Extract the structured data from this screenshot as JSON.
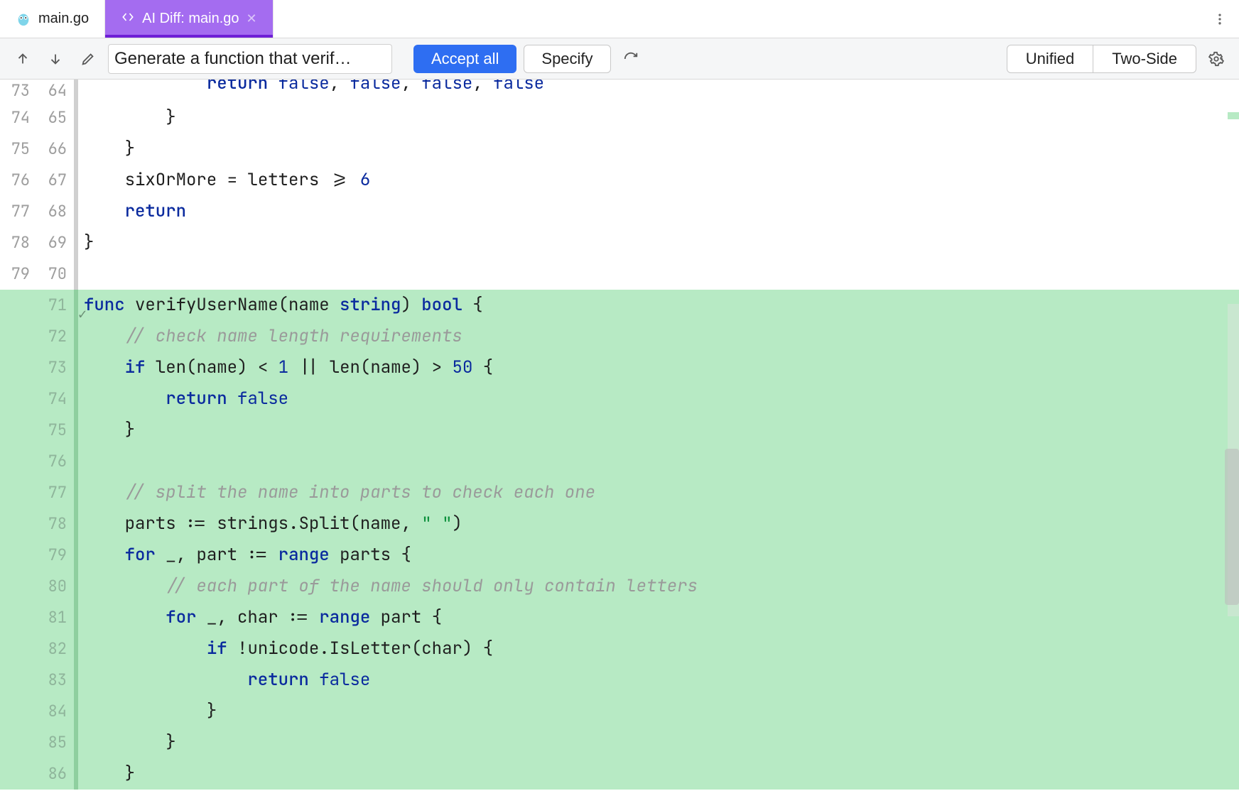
{
  "tabs": {
    "file_tab": {
      "label": "main.go"
    },
    "diff_tab": {
      "label": "AI Diff: main.go"
    }
  },
  "toolbar": {
    "prompt_label": "Generate a function that verif…",
    "accept_label": "Accept all",
    "specify_label": "Specify",
    "view_unified": "Unified",
    "view_twoside": "Two-Side"
  },
  "lines": [
    {
      "lold": "73",
      "lnew": "64",
      "added": false,
      "peek": true,
      "tokens": [
        [
          "",
          "            "
        ],
        [
          "kw",
          "return"
        ],
        [
          "",
          " "
        ],
        [
          "bool",
          "false"
        ],
        [
          "op",
          ", "
        ],
        [
          "bool",
          "false"
        ],
        [
          "op",
          ", "
        ],
        [
          "bool",
          "false"
        ],
        [
          "op",
          ", "
        ],
        [
          "bool",
          "false"
        ]
      ]
    },
    {
      "lold": "74",
      "lnew": "65",
      "added": false,
      "tokens": [
        [
          "",
          "        "
        ],
        [
          "op",
          "}"
        ]
      ]
    },
    {
      "lold": "75",
      "lnew": "66",
      "added": false,
      "tokens": [
        [
          "",
          "    "
        ],
        [
          "op",
          "}"
        ]
      ]
    },
    {
      "lold": "76",
      "lnew": "67",
      "added": false,
      "tokens": [
        [
          "",
          "    "
        ],
        [
          "id",
          "sixOrMore"
        ],
        [
          "",
          " "
        ],
        [
          "op",
          "="
        ],
        [
          "",
          " "
        ],
        [
          "id",
          "letters"
        ],
        [
          "",
          " "
        ],
        [
          "op",
          ">="
        ],
        [
          "",
          " "
        ],
        [
          "num",
          "6"
        ]
      ]
    },
    {
      "lold": "77",
      "lnew": "68",
      "added": false,
      "tokens": [
        [
          "",
          "    "
        ],
        [
          "kw",
          "return"
        ]
      ]
    },
    {
      "lold": "78",
      "lnew": "69",
      "added": false,
      "tokens": [
        [
          "op",
          "}"
        ]
      ]
    },
    {
      "lold": "79",
      "lnew": "70",
      "added": false,
      "tokens": [
        [
          "",
          ""
        ]
      ]
    },
    {
      "lold": "",
      "lnew": "71",
      "added": true,
      "check": true,
      "tokens": [
        [
          "kw",
          "func"
        ],
        [
          "",
          " "
        ],
        [
          "id",
          "verifyUserName"
        ],
        [
          "op",
          "("
        ],
        [
          "id",
          "name"
        ],
        [
          "",
          " "
        ],
        [
          "kw",
          "string"
        ],
        [
          "op",
          ")"
        ],
        [
          "",
          " "
        ],
        [
          "kw",
          "bool"
        ],
        [
          "",
          " "
        ],
        [
          "op",
          "{"
        ]
      ]
    },
    {
      "lold": "",
      "lnew": "72",
      "added": true,
      "tokens": [
        [
          "",
          "    "
        ],
        [
          "cmt",
          "// check name length requirements"
        ]
      ]
    },
    {
      "lold": "",
      "lnew": "73",
      "added": true,
      "tokens": [
        [
          "",
          "    "
        ],
        [
          "kw",
          "if"
        ],
        [
          "",
          " "
        ],
        [
          "id",
          "len"
        ],
        [
          "op",
          "("
        ],
        [
          "id",
          "name"
        ],
        [
          "op",
          ")"
        ],
        [
          "",
          " "
        ],
        [
          "op",
          "<"
        ],
        [
          "",
          " "
        ],
        [
          "num",
          "1"
        ],
        [
          "",
          " "
        ],
        [
          "op",
          "||"
        ],
        [
          "",
          " "
        ],
        [
          "id",
          "len"
        ],
        [
          "op",
          "("
        ],
        [
          "id",
          "name"
        ],
        [
          "op",
          ")"
        ],
        [
          "",
          " "
        ],
        [
          "op",
          ">"
        ],
        [
          "",
          " "
        ],
        [
          "num",
          "50"
        ],
        [
          "",
          " "
        ],
        [
          "op",
          "{"
        ]
      ]
    },
    {
      "lold": "",
      "lnew": "74",
      "added": true,
      "tokens": [
        [
          "",
          "        "
        ],
        [
          "kw",
          "return"
        ],
        [
          "",
          " "
        ],
        [
          "bool",
          "false"
        ]
      ]
    },
    {
      "lold": "",
      "lnew": "75",
      "added": true,
      "tokens": [
        [
          "",
          "    "
        ],
        [
          "op",
          "}"
        ]
      ]
    },
    {
      "lold": "",
      "lnew": "76",
      "added": true,
      "tokens": [
        [
          "",
          ""
        ]
      ]
    },
    {
      "lold": "",
      "lnew": "77",
      "added": true,
      "tokens": [
        [
          "",
          "    "
        ],
        [
          "cmt",
          "// split the name into parts to check each one"
        ]
      ]
    },
    {
      "lold": "",
      "lnew": "78",
      "added": true,
      "tokens": [
        [
          "",
          "    "
        ],
        [
          "id",
          "parts"
        ],
        [
          "",
          " "
        ],
        [
          "op",
          ":="
        ],
        [
          "",
          " "
        ],
        [
          "id",
          "strings"
        ],
        [
          "op",
          "."
        ],
        [
          "id",
          "Split"
        ],
        [
          "op",
          "("
        ],
        [
          "id",
          "name"
        ],
        [
          "op",
          ", "
        ],
        [
          "str",
          "\" \""
        ],
        [
          "op",
          ")"
        ]
      ]
    },
    {
      "lold": "",
      "lnew": "79",
      "added": true,
      "tokens": [
        [
          "",
          "    "
        ],
        [
          "kw",
          "for"
        ],
        [
          "",
          " "
        ],
        [
          "id",
          "_"
        ],
        [
          "op",
          ", "
        ],
        [
          "id",
          "part"
        ],
        [
          "",
          " "
        ],
        [
          "op",
          ":="
        ],
        [
          "",
          " "
        ],
        [
          "kw",
          "range"
        ],
        [
          "",
          " "
        ],
        [
          "id",
          "parts"
        ],
        [
          "",
          " "
        ],
        [
          "op",
          "{"
        ]
      ]
    },
    {
      "lold": "",
      "lnew": "80",
      "added": true,
      "tokens": [
        [
          "",
          "        "
        ],
        [
          "cmt",
          "// each part of the name should only contain letters"
        ]
      ]
    },
    {
      "lold": "",
      "lnew": "81",
      "added": true,
      "tokens": [
        [
          "",
          "        "
        ],
        [
          "kw",
          "for"
        ],
        [
          "",
          " "
        ],
        [
          "id",
          "_"
        ],
        [
          "op",
          ", "
        ],
        [
          "id",
          "char"
        ],
        [
          "",
          " "
        ],
        [
          "op",
          ":="
        ],
        [
          "",
          " "
        ],
        [
          "kw",
          "range"
        ],
        [
          "",
          " "
        ],
        [
          "id",
          "part"
        ],
        [
          "",
          " "
        ],
        [
          "op",
          "{"
        ]
      ]
    },
    {
      "lold": "",
      "lnew": "82",
      "added": true,
      "tokens": [
        [
          "",
          "            "
        ],
        [
          "kw",
          "if"
        ],
        [
          "",
          " "
        ],
        [
          "op",
          "!"
        ],
        [
          "id",
          "unicode"
        ],
        [
          "op",
          "."
        ],
        [
          "id",
          "IsLetter"
        ],
        [
          "op",
          "("
        ],
        [
          "id",
          "char"
        ],
        [
          "op",
          ")"
        ],
        [
          "",
          " "
        ],
        [
          "op",
          "{"
        ]
      ]
    },
    {
      "lold": "",
      "lnew": "83",
      "added": true,
      "tokens": [
        [
          "",
          "                "
        ],
        [
          "kw",
          "return"
        ],
        [
          "",
          " "
        ],
        [
          "bool",
          "false"
        ]
      ]
    },
    {
      "lold": "",
      "lnew": "84",
      "added": true,
      "tokens": [
        [
          "",
          "            "
        ],
        [
          "op",
          "}"
        ]
      ]
    },
    {
      "lold": "",
      "lnew": "85",
      "added": true,
      "tokens": [
        [
          "",
          "        "
        ],
        [
          "op",
          "}"
        ]
      ]
    },
    {
      "lold": "",
      "lnew": "86",
      "added": true,
      "tokens": [
        [
          "",
          "    "
        ],
        [
          "op",
          "}"
        ]
      ]
    }
  ]
}
